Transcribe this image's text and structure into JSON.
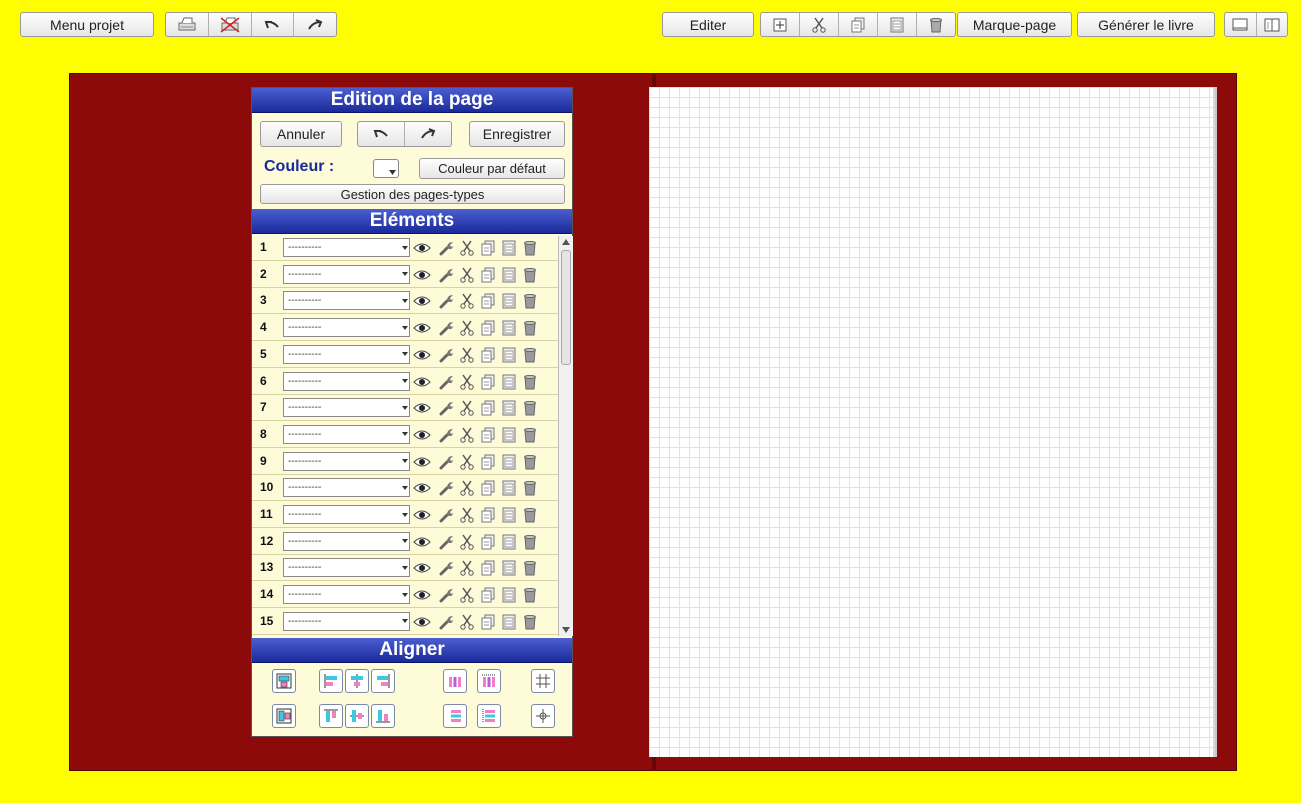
{
  "toolbar": {
    "menu_project": "Menu projet",
    "edit": "Editer",
    "bookmark": "Marque-page",
    "generate_book": "Générer le livre"
  },
  "panel": {
    "title": "Edition de la page",
    "cancel": "Annuler",
    "save": "Enregistrer",
    "color_label": "Couleur :",
    "default_color": "Couleur par défaut",
    "page_types": "Gestion des pages-types",
    "elements_title": "Eléments",
    "align_title": "Aligner"
  },
  "elements": [
    {
      "num": "1",
      "value": "----------"
    },
    {
      "num": "2",
      "value": "----------"
    },
    {
      "num": "3",
      "value": "----------"
    },
    {
      "num": "4",
      "value": "----------"
    },
    {
      "num": "5",
      "value": "----------"
    },
    {
      "num": "6",
      "value": "----------"
    },
    {
      "num": "7",
      "value": "----------"
    },
    {
      "num": "8",
      "value": "----------"
    },
    {
      "num": "9",
      "value": "----------"
    },
    {
      "num": "10",
      "value": "----------"
    },
    {
      "num": "11",
      "value": "----------"
    },
    {
      "num": "12",
      "value": "----------"
    },
    {
      "num": "13",
      "value": "----------"
    },
    {
      "num": "14",
      "value": "----------"
    },
    {
      "num": "15",
      "value": "----------"
    }
  ],
  "element_icons": [
    "eye-icon",
    "wrench-icon",
    "scissors-icon",
    "copy-icon",
    "paste-icon",
    "trash-icon"
  ],
  "colors": {
    "background": "#fefe00",
    "board": "#8c0a0a",
    "header": "#1a2a9a",
    "panel": "#fdfbd8",
    "label": "#1a2a9a"
  }
}
